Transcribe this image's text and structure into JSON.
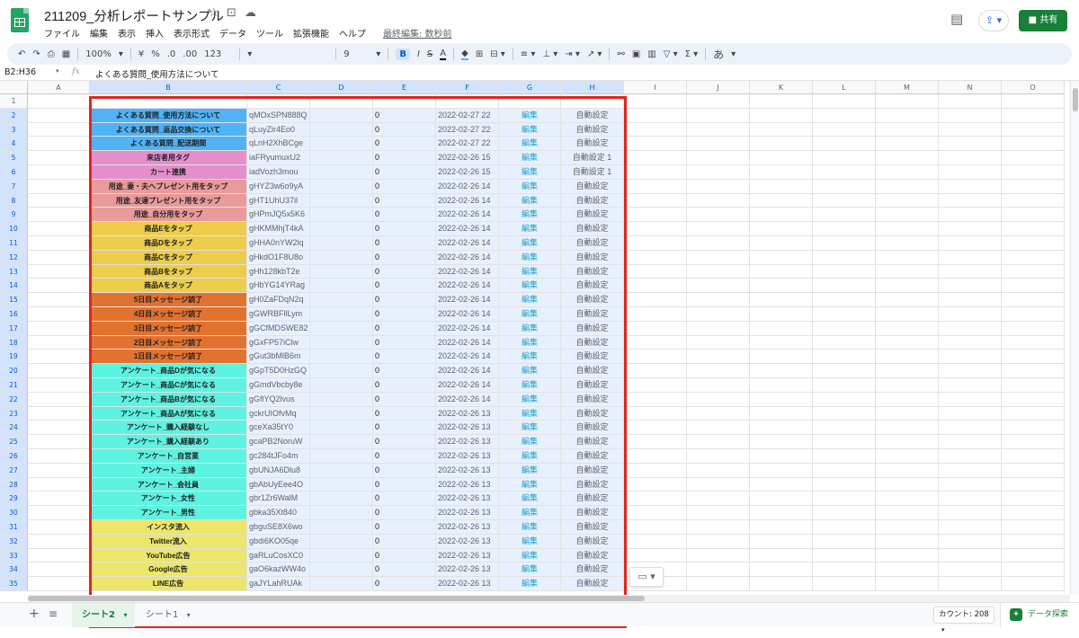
{
  "app": {
    "doc_title": "211209_分析レポートサンプル",
    "menus": [
      "ファイル",
      "編集",
      "表示",
      "挿入",
      "表示形式",
      "データ",
      "ツール",
      "拡張機能",
      "ヘルプ"
    ],
    "last_edit": "最終編集: 数秒前",
    "share_label": "共有"
  },
  "toolbar": {
    "zoom": "100%",
    "currency": "¥",
    "percent": "%",
    "dec_less": ".0",
    "dec_more": ".00",
    "format": "123",
    "font_size": "9",
    "bold": "B",
    "italic": "I",
    "strike": "S",
    "text_color": "A",
    "input_tools": "あ"
  },
  "formula_bar": {
    "name_box": "B2:H36",
    "fx": "fx",
    "content": "よくある質問_使用方法について"
  },
  "columns": [
    "A",
    "B",
    "C",
    "D",
    "E",
    "F",
    "G",
    "H",
    "I",
    "J",
    "K",
    "L",
    "M",
    "N",
    "O"
  ],
  "rows": [
    {
      "num": "1",
      "b": "",
      "c": "",
      "e": "",
      "f": "",
      "g": "",
      "h": "",
      "color": ""
    },
    {
      "num": "2",
      "b": "よくある質問_使用方法について",
      "c": "qMOxSPN888Q",
      "e": "0",
      "f": "2022-02-27 22",
      "g": "編集",
      "h": "自動設定",
      "color": "#4fb3f6"
    },
    {
      "num": "3",
      "b": "よくある質問_返品交換について",
      "c": "qLuyZir4Eo0",
      "e": "0",
      "f": "2022-02-27 22",
      "g": "編集",
      "h": "自動設定",
      "color": "#4fb3f6"
    },
    {
      "num": "4",
      "b": "よくある質問_配送期間",
      "c": "qLnH2XhBCge",
      "e": "0",
      "f": "2022-02-27 22",
      "g": "編集",
      "h": "自動設定",
      "color": "#4fb3f6"
    },
    {
      "num": "5",
      "b": "来店者用タグ",
      "c": "iaFRyumuxU2",
      "e": "0",
      "f": "2022-02-26 15",
      "g": "編集",
      "h": "自動設定 1",
      "color": "#e48fcc"
    },
    {
      "num": "6",
      "b": "カート連携",
      "c": "iadVozh3mou",
      "e": "0",
      "f": "2022-02-26 15",
      "g": "編集",
      "h": "自動設定 1",
      "color": "#e48fcc"
    },
    {
      "num": "7",
      "b": "用途_妻・夫へプレゼント用をタップ",
      "c": "gHYZ3w6o9yA",
      "e": "0",
      "f": "2022-02-26 14",
      "g": "編集",
      "h": "自動設定",
      "color": "#e99a9a"
    },
    {
      "num": "8",
      "b": "用途_友達プレゼント用をタップ",
      "c": "gHT1UhU37il",
      "e": "0",
      "f": "2022-02-26 14",
      "g": "編集",
      "h": "自動設定",
      "color": "#e99a9a"
    },
    {
      "num": "9",
      "b": "用途_自分用をタップ",
      "c": "gHPmJQ5x5K6",
      "e": "0",
      "f": "2022-02-26 14",
      "g": "編集",
      "h": "自動設定",
      "color": "#e99a9a"
    },
    {
      "num": "10",
      "b": "商品Eをタップ",
      "c": "gHKMMhjT4kA",
      "e": "0",
      "f": "2022-02-26 14",
      "g": "編集",
      "h": "自動設定",
      "color": "#edcd4b"
    },
    {
      "num": "11",
      "b": "商品Dをタップ",
      "c": "gHHA0nYW2lq",
      "e": "0",
      "f": "2022-02-26 14",
      "g": "編集",
      "h": "自動設定",
      "color": "#edcd4b"
    },
    {
      "num": "12",
      "b": "商品Cをタップ",
      "c": "gHkdO1F8U8o",
      "e": "0",
      "f": "2022-02-26 14",
      "g": "編集",
      "h": "自動設定",
      "color": "#edcd4b"
    },
    {
      "num": "13",
      "b": "商品Bをタップ",
      "c": "gHh128kbT2e",
      "e": "0",
      "f": "2022-02-26 14",
      "g": "編集",
      "h": "自動設定",
      "color": "#edcd4b"
    },
    {
      "num": "14",
      "b": "商品Aをタップ",
      "c": "gHbYG14YRag",
      "e": "0",
      "f": "2022-02-26 14",
      "g": "編集",
      "h": "自動設定",
      "color": "#edcd4b"
    },
    {
      "num": "15",
      "b": "5日目メッセージ読了",
      "c": "gH0ZaFDqN2q",
      "e": "0",
      "f": "2022-02-26 14",
      "g": "編集",
      "h": "自動設定",
      "color": "#e2722f"
    },
    {
      "num": "16",
      "b": "4日目メッセージ読了",
      "c": "gGWRBFllLym",
      "e": "0",
      "f": "2022-02-26 14",
      "g": "編集",
      "h": "自動設定",
      "color": "#e2722f"
    },
    {
      "num": "17",
      "b": "3日目メッセージ読了",
      "c": "gGCfMDSWE82",
      "e": "0",
      "f": "2022-02-26 14",
      "g": "編集",
      "h": "自動設定",
      "color": "#e2722f"
    },
    {
      "num": "18",
      "b": "2日目メッセージ読了",
      "c": "gGxFP57iClw",
      "e": "0",
      "f": "2022-02-26 14",
      "g": "編集",
      "h": "自動設定",
      "color": "#e2722f"
    },
    {
      "num": "19",
      "b": "1日目メッセージ読了",
      "c": "gGut3bMlB6m",
      "e": "0",
      "f": "2022-02-26 14",
      "g": "編集",
      "h": "自動設定",
      "color": "#e2722f"
    },
    {
      "num": "20",
      "b": "アンケート_商品Dが気になる",
      "c": "gGpT5D0HzGQ",
      "e": "0",
      "f": "2022-02-26 14",
      "g": "編集",
      "h": "自動設定",
      "color": "#5ef2e0"
    },
    {
      "num": "21",
      "b": "アンケート_商品Cが気になる",
      "c": "gGmdVbcby8e",
      "e": "0",
      "f": "2022-02-26 14",
      "g": "編集",
      "h": "自動設定",
      "color": "#5ef2e0"
    },
    {
      "num": "22",
      "b": "アンケート_商品Bが気になる",
      "c": "gGflYQ2lvus",
      "e": "0",
      "f": "2022-02-26 14",
      "g": "編集",
      "h": "自動設定",
      "color": "#5ef2e0"
    },
    {
      "num": "23",
      "b": "アンケート_商品Aが気になる",
      "c": "gckrUIOfvMq",
      "e": "0",
      "f": "2022-02-26 13",
      "g": "編集",
      "h": "自動設定",
      "color": "#5ef2e0"
    },
    {
      "num": "24",
      "b": "アンケート_購入経験なし",
      "c": "gceXa35tY0",
      "e": "0",
      "f": "2022-02-26 13",
      "g": "編集",
      "h": "自動設定",
      "color": "#5ef2e0"
    },
    {
      "num": "25",
      "b": "アンケート_購入経験あり",
      "c": "gcaPB2NoruW",
      "e": "0",
      "f": "2022-02-26 13",
      "g": "編集",
      "h": "自動設定",
      "color": "#5ef2e0"
    },
    {
      "num": "26",
      "b": "アンケート_自営業",
      "c": "gc284tJFo4m",
      "e": "0",
      "f": "2022-02-26 13",
      "g": "編集",
      "h": "自動設定",
      "color": "#5ef2e0"
    },
    {
      "num": "27",
      "b": "アンケート_主婦",
      "c": "gbUNJA6Dlu8",
      "e": "0",
      "f": "2022-02-26 13",
      "g": "編集",
      "h": "自動設定",
      "color": "#5ef2e0"
    },
    {
      "num": "28",
      "b": "アンケート_会社員",
      "c": "gbAbUyEee4O",
      "e": "0",
      "f": "2022-02-26 13",
      "g": "編集",
      "h": "自動設定",
      "color": "#5ef2e0"
    },
    {
      "num": "29",
      "b": "アンケート_女性",
      "c": "gbr1Zr6WalM",
      "e": "0",
      "f": "2022-02-26 13",
      "g": "編集",
      "h": "自動設定",
      "color": "#5ef2e0"
    },
    {
      "num": "30",
      "b": "アンケート_男性",
      "c": "gbka35Xt840",
      "e": "0",
      "f": "2022-02-26 13",
      "g": "編集",
      "h": "自動設定",
      "color": "#5ef2e0"
    },
    {
      "num": "31",
      "b": "インスタ流入",
      "c": "gbguSE8X6wo",
      "e": "0",
      "f": "2022-02-26 13",
      "g": "編集",
      "h": "自動設定",
      "color": "#ece66a"
    },
    {
      "num": "32",
      "b": "Twitter流入",
      "c": "gbdi6KO05qe",
      "e": "0",
      "f": "2022-02-26 13",
      "g": "編集",
      "h": "自動設定",
      "color": "#ece66a"
    },
    {
      "num": "33",
      "b": "YouTube広告",
      "c": "gaRLuCosXC0",
      "e": "0",
      "f": "2022-02-26 13",
      "g": "編集",
      "h": "自動設定",
      "color": "#ece66a"
    },
    {
      "num": "34",
      "b": "Google広告",
      "c": "gaO6kazWW4o",
      "e": "0",
      "f": "2022-02-26 13",
      "g": "編集",
      "h": "自動設定",
      "color": "#ece66a"
    },
    {
      "num": "35",
      "b": "LINE広告",
      "c": "gaJYLahRUAk",
      "e": "0",
      "f": "2022-02-26 13",
      "g": "編集",
      "h": "自動設定",
      "color": "#ece66a"
    }
  ],
  "bottom": {
    "add_sheet": "+",
    "sheet_list": "≡",
    "active_tab": "シート2",
    "inactive_tab": "シート1",
    "count": "カウント: 208",
    "explore": "データ探索"
  },
  "icons": {
    "star": "☆",
    "folder": "⊡",
    "cloud": "☁",
    "comment": "▤",
    "lock": "🔒",
    "paste": "📋",
    "dropdown": "▾"
  },
  "colors": {
    "accent_green": "#188038",
    "highlight_red": "#e1251b",
    "selection_blue": "#e8f0fd",
    "link_teal": "#1aa3c8"
  }
}
